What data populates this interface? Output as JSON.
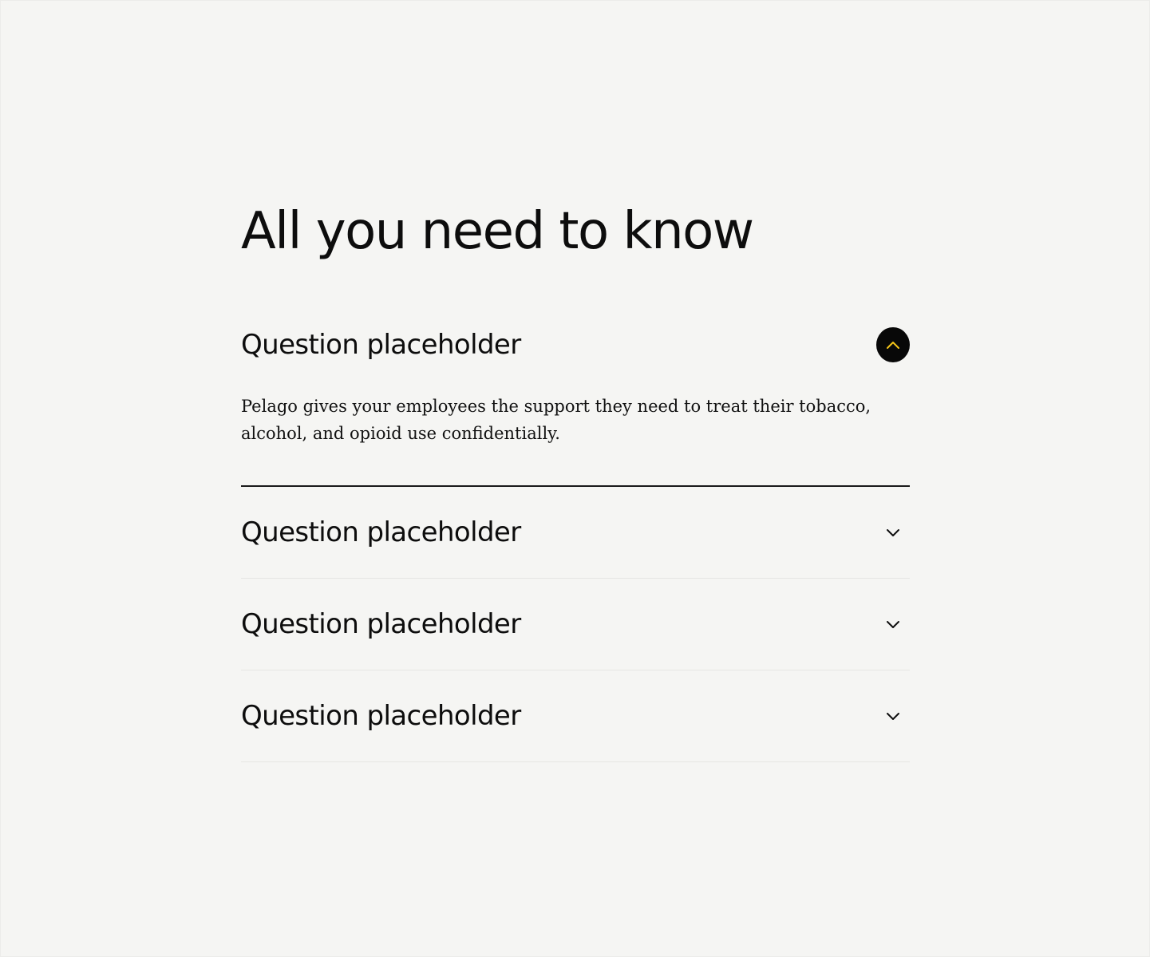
{
  "faq": {
    "title": "All you need to know",
    "items": [
      {
        "question": "Question placeholder",
        "expanded": true,
        "answer": "Pelago gives your employees the support they need to treat their tobacco, alcohol, and opioid use confidentially.",
        "toggle_icon": "chevron-up-icon"
      },
      {
        "question": "Question placeholder",
        "expanded": false,
        "toggle_icon": "chevron-down-icon"
      },
      {
        "question": "Question placeholder",
        "expanded": false,
        "toggle_icon": "chevron-down-icon"
      },
      {
        "question": "Question placeholder",
        "expanded": false,
        "toggle_icon": "chevron-down-icon"
      }
    ]
  },
  "colors": {
    "background": "#f5f5f3",
    "text": "#0d0d0d",
    "toggle_bg": "#080808",
    "toggle_accent": "#f5c518"
  }
}
